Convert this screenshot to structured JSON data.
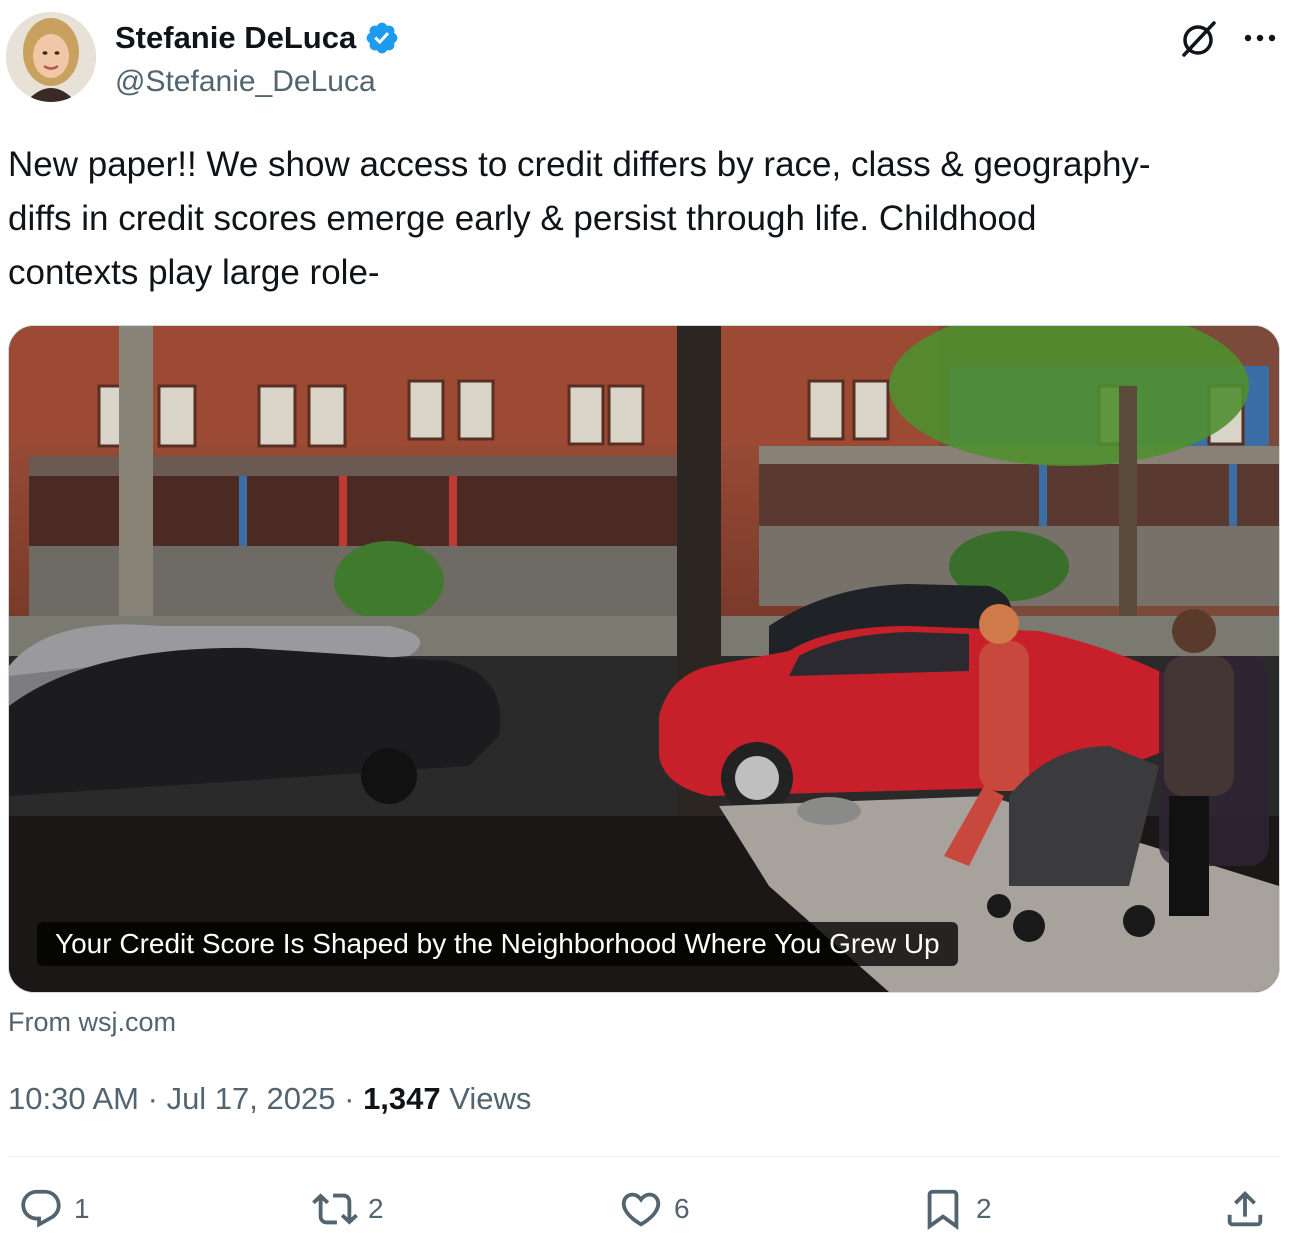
{
  "author": {
    "display_name": "Stefanie DeLuca",
    "handle": "@Stefanie_DeLuca",
    "verified": true,
    "avatar_icon": "avatar-photo"
  },
  "header_icons": {
    "grok": "grok-icon",
    "more": "more-icon",
    "more_glyph": "···"
  },
  "tweet": {
    "text": "New paper!! We show access to credit differs by race, class & geography-\ndiffs in credit scores emerge early & persist through life. Childhood\ncontexts play large role-"
  },
  "media": {
    "caption": "Your Credit Score Is Shaped by the Neighborhood Where You Grew Up",
    "source": "From wsj.com"
  },
  "meta": {
    "time": "10:30 AM",
    "separator": "·",
    "date": "Jul 17, 2025",
    "views_count": "1,347",
    "views_label": "Views"
  },
  "actions": {
    "reply_count": "1",
    "repost_count": "2",
    "like_count": "6",
    "bookmark_count": "2"
  },
  "colors": {
    "text_primary": "#0f1419",
    "text_secondary": "#536471",
    "verified": "#1d9bf0",
    "border": "#cfd9de"
  }
}
